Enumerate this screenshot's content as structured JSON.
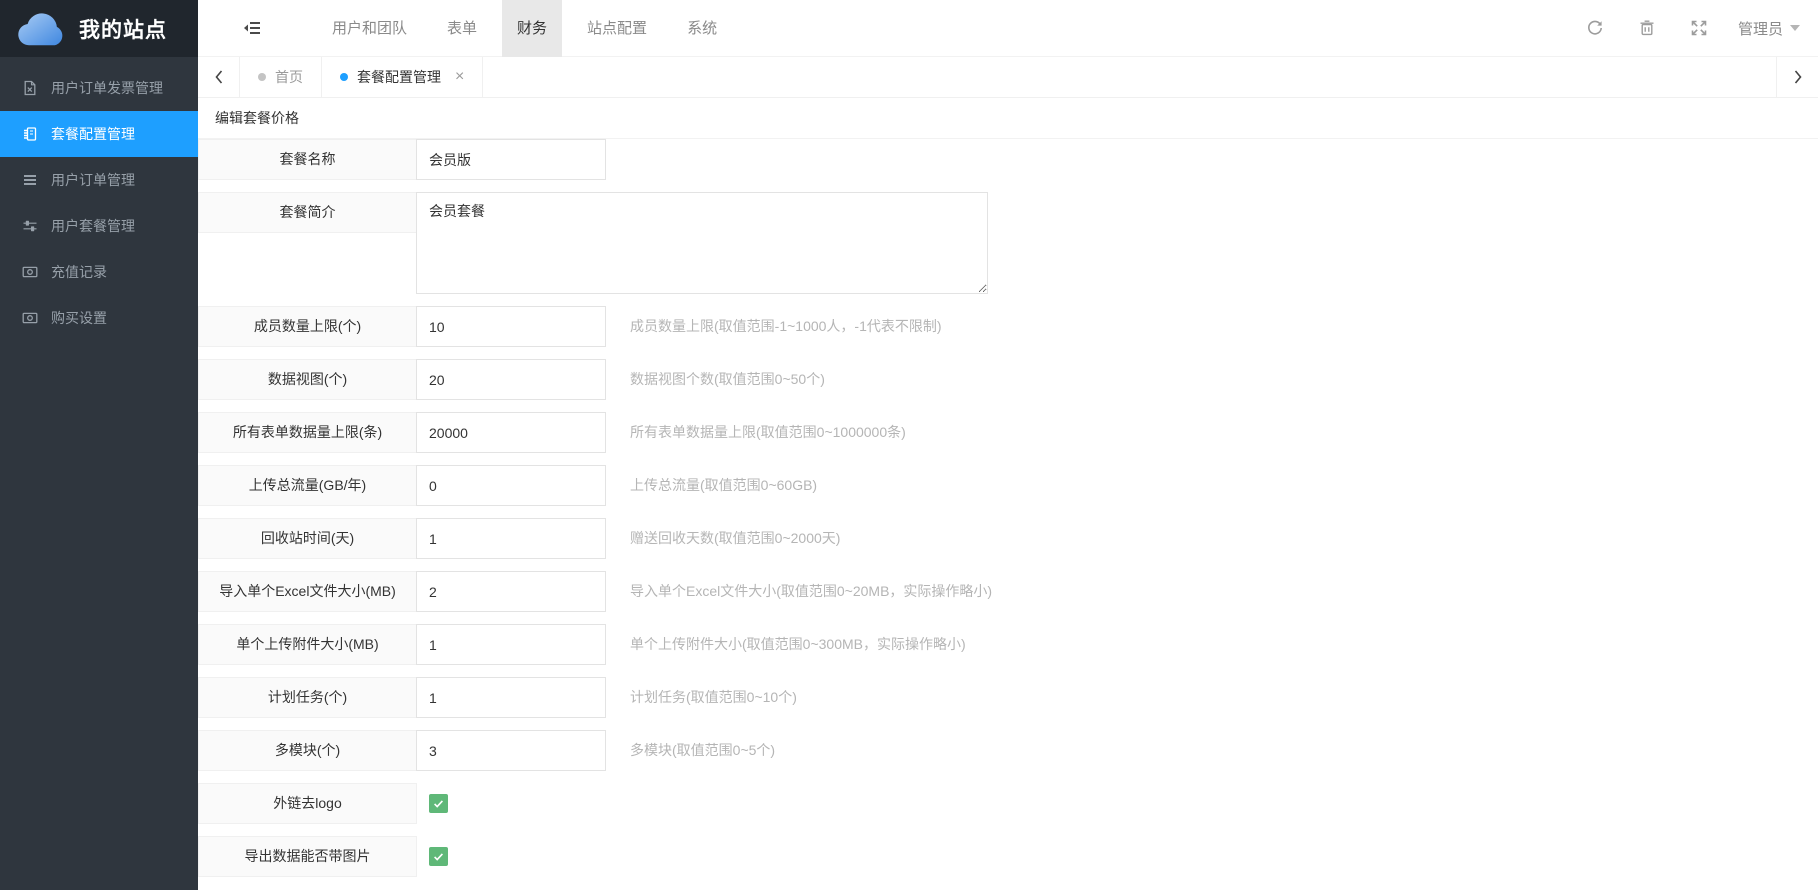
{
  "colors": {
    "accent_blue": "#1e9fff",
    "checkbox_green": "#5fb878",
    "sidebar_bg": "#2f363e",
    "logo_bg": "#20262d",
    "active_nav_bg": "#e8e8e8"
  },
  "sidebar": {
    "logo_title": "我的站点",
    "logo_icon": "cloud-icon",
    "items": [
      {
        "label": "用户订单发票管理",
        "icon": "invoice-file-icon",
        "active": false
      },
      {
        "label": "套餐配置管理",
        "icon": "package-icon",
        "active": true
      },
      {
        "label": "用户订单管理",
        "icon": "list-icon",
        "active": false
      },
      {
        "label": "用户套餐管理",
        "icon": "sliders-icon",
        "active": false
      },
      {
        "label": "充值记录",
        "icon": "banknote-icon",
        "active": false
      },
      {
        "label": "购买设置",
        "icon": "banknote-icon",
        "active": false
      }
    ]
  },
  "topnav": {
    "collapse_icon": "collapse-menu-icon",
    "items": [
      {
        "label": "用户和团队",
        "active": false
      },
      {
        "label": "表单",
        "active": false
      },
      {
        "label": "财务",
        "active": true
      },
      {
        "label": "站点配置",
        "active": false
      },
      {
        "label": "系统",
        "active": false
      }
    ],
    "tools": [
      "refresh-icon",
      "trash-icon",
      "fullscreen-icon"
    ],
    "user_name": "管理员"
  },
  "tabbar": {
    "scroll_left_icon": "chevron-left-icon",
    "scroll_right_icon": "chevron-right-icon",
    "close_glyph": "×",
    "tabs": [
      {
        "label": "首页",
        "active": false,
        "closable": false
      },
      {
        "label": "套餐配置管理",
        "active": true,
        "closable": true
      }
    ]
  },
  "form": {
    "title": "编辑套餐价格",
    "rows": [
      {
        "type": "text",
        "label": "套餐名称",
        "value": "会员版",
        "hint": ""
      },
      {
        "type": "textarea",
        "label": "套餐简介",
        "value": "会员套餐",
        "hint": ""
      },
      {
        "type": "text",
        "label": "成员数量上限(个)",
        "value": "10",
        "hint": "成员数量上限(取值范围-1~1000人，-1代表不限制)"
      },
      {
        "type": "text",
        "label": "数据视图(个)",
        "value": "20",
        "hint": "数据视图个数(取值范围0~50个)"
      },
      {
        "type": "text",
        "label": "所有表单数据量上限(条)",
        "value": "20000",
        "hint": "所有表单数据量上限(取值范围0~1000000条)"
      },
      {
        "type": "text",
        "label": "上传总流量(GB/年)",
        "value": "0",
        "hint": "上传总流量(取值范围0~60GB)"
      },
      {
        "type": "text",
        "label": "回收站时间(天)",
        "value": "1",
        "hint": "赠送回收天数(取值范围0~2000天)"
      },
      {
        "type": "text",
        "label": "导入单个Excel文件大小(MB)",
        "value": "2",
        "hint": "导入单个Excel文件大小(取值范围0~20MB，实际操作略小)"
      },
      {
        "type": "text",
        "label": "单个上传附件大小(MB)",
        "value": "1",
        "hint": "单个上传附件大小(取值范围0~300MB，实际操作略小)"
      },
      {
        "type": "text",
        "label": "计划任务(个)",
        "value": "1",
        "hint": "计划任务(取值范围0~10个)"
      },
      {
        "type": "text",
        "label": "多模块(个)",
        "value": "3",
        "hint": "多模块(取值范围0~5个)"
      },
      {
        "type": "checkbox",
        "label": "外链去logo",
        "checked": true
      },
      {
        "type": "checkbox",
        "label": "导出数据能否带图片",
        "checked": true
      }
    ]
  }
}
